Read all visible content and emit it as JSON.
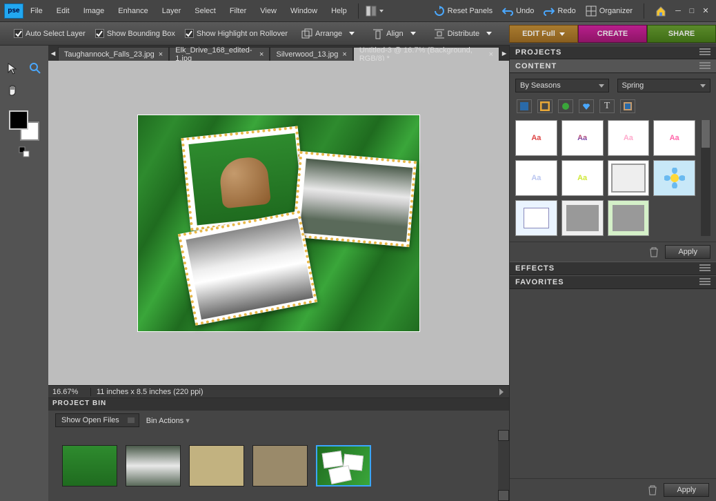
{
  "menu": {
    "items": [
      "File",
      "Edit",
      "Image",
      "Enhance",
      "Layer",
      "Select",
      "Filter",
      "View",
      "Window",
      "Help"
    ],
    "reset": "Reset Panels",
    "undo": "Undo",
    "redo": "Redo",
    "organizer": "Organizer"
  },
  "options": {
    "auto_select": "Auto Select Layer",
    "bounding": "Show Bounding Box",
    "highlight": "Show Highlight on Rollover",
    "arrange": "Arrange",
    "align": "Align",
    "distribute": "Distribute",
    "edit": "EDIT Full",
    "create": "CREATE",
    "share": "SHARE"
  },
  "tabs": [
    {
      "label": "Taughannock_Falls_23.jpg",
      "active": false
    },
    {
      "label": "Elk_Drive_168_edited-1.jpg",
      "active": false
    },
    {
      "label": "Silverwood_13.jpg",
      "active": false
    },
    {
      "label": "Untitled-3 @ 16.7% (Background, RGB/8) *",
      "active": true
    }
  ],
  "status": {
    "zoom": "16.67%",
    "info": "11 inches x 8.5 inches (220 ppi)"
  },
  "projectbin": {
    "title": "PROJECT BIN",
    "show_open": "Show Open Files",
    "bin_actions": "Bin Actions"
  },
  "panels": {
    "projects": "PROJECTS",
    "content": "CONTENT",
    "effects": "EFFECTS",
    "favorites": "FAVORITES",
    "by_seasons": "By Seasons",
    "spring": "Spring",
    "apply": "Apply"
  },
  "logo": "pse"
}
